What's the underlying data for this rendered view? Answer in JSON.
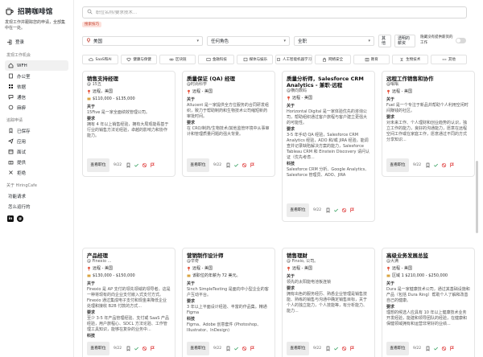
{
  "app": {
    "title": "招聘咖啡馆",
    "tagline": "发现工作并跟踪您的申请，全部集中在一处。",
    "login": "登录"
  },
  "sidebar": {
    "section_work": "发现工作机会",
    "items": [
      {
        "label": "WFH",
        "icon": "home-icon"
      },
      {
        "label": "办公室",
        "icon": "building-icon"
      },
      {
        "label": "依据",
        "icon": "grid-icon"
      },
      {
        "label": "通信",
        "icon": "chat-icon"
      },
      {
        "label": "麻痹",
        "icon": "puzzle-icon"
      }
    ],
    "section_track": "追踪申请",
    "track_items": [
      {
        "label": "已保存",
        "icon": "bookmark-icon"
      },
      {
        "label": "应用",
        "icon": "send-icon"
      },
      {
        "label": "面试",
        "icon": "calendar-icon"
      },
      {
        "label": "提供",
        "icon": "gift-icon"
      },
      {
        "label": "拒绝",
        "icon": "x-icon"
      }
    ],
    "section_about": "关于 HiringCafe",
    "about_items": [
      {
        "label": "功能请求"
      },
      {
        "label": "怎么运行的"
      }
    ],
    "social": [
      "in",
      "@"
    ]
  },
  "search": {
    "placeholder": "职位名称/要求技术..."
  },
  "active_tag": "搜索技巧",
  "filters": {
    "location": "美国",
    "role": "任何角色",
    "time": "全职",
    "more_label": "其他",
    "salary_label": "透明的薪资",
    "hide_label": "隐藏没有提供薪资的工作"
  },
  "categories": [
    {
      "label": "SaaS和AI",
      "icon": "cloud-icon"
    },
    {
      "label": "健康与保健",
      "icon": "heart-icon"
    },
    {
      "label": "区块链",
      "icon": "link-icon"
    },
    {
      "label": "金融科技",
      "icon": "card-icon"
    },
    {
      "label": "媒体与娱乐",
      "icon": "film-icon"
    },
    {
      "label": "人工智能机器学习",
      "icon": "cpu-icon"
    },
    {
      "label": "网络安全",
      "icon": "lock-icon"
    },
    {
      "label": "教育",
      "icon": "book-icon"
    },
    {
      "label": "生物技术",
      "icon": "dna-icon"
    },
    {
      "label": "其他",
      "icon": "dots-icon"
    }
  ],
  "cards": [
    {
      "title": "销售支持经理",
      "company": "@ 15五",
      "location": "远程，美国",
      "salary": "$110,000 - $135,000",
      "about_label": "关于",
      "about": "15Five 是一家全面绩效管理公司。",
      "req_label": "要求",
      "req": "拥有 4 年以上销售经验，拥有大局观能看基于行业的销售方法论经验，卓越的影响力和协作能力。",
      "date": "9/22",
      "view": "查看职位"
    },
    {
      "title": "质量保证 (QA) 经理",
      "company": "@时尚科学",
      "location": "远程 - 美国",
      "salary": "",
      "about_label": "关于",
      "about": "Allucent 是一家提供全方位服务的合同研发组织，致力于帮助制药和生物技术公司缩短新药审批时间。",
      "req_label": "要求",
      "req": "在 CRO/制药/生物技术/其他监管环境中从事审计和管理质量问题的强大背景。",
      "date": "9/22",
      "view": "查看职位"
    },
    {
      "title": "质量分析师，Salesforce CRM Analytics - 兼职·远程",
      "company": "@横向数码",
      "location": "远程 - 美国",
      "salary": "",
      "about_label": "关于",
      "about": "Horizontal Digital 是一家体验优先的咨询公司，帮助组织通过客户旅程与客户建立更强大的可能性。",
      "req_label": "要求",
      "req": "3-5 年手动 QA 经验，Salesforce CRM Analytics 经验，ADO 和/或 JIRA 经验，能调查并记录缺陷解决方案的能力，Salesforce Tableau CRM 和 Einstein Discovery 请问认证（优先考虑...",
      "tech_label": "科技",
      "tech": "Salesforce CRM 分析、Google Analytics、Salesforce 管理员、ADO、JIRA",
      "date": "9/22",
      "view": "查看职位"
    },
    {
      "title": "远程工作销售和协作",
      "company": "@嗡嗡",
      "location": "远程 - 美国",
      "salary": "",
      "about_label": "关于",
      "about": "Fuel 是一个专注于新品并帮助个人利用空闲时间赚钱的社区。",
      "req_label": "要求",
      "req": "对未来工作、个人理财和创业趋势的认识，独立工作的能力，良好的沟通能力，愿意在远程空间工作或在家庭工作，愿意通过不同的方式分享知识...",
      "date": "9/22",
      "view": "查看职位"
    },
    {
      "title": "产品经理",
      "company": "@ Finexio ...",
      "location": "远程 - 美国",
      "salary": "$130,000 - $150,000",
      "about_label": "关于",
      "about": "Finexio 是 AP 支付的领先领域的领导者。这是一种将现有的向企业支付嵌入式支付方式。Finexio 通过集成电子支付和现金来降低企业处理和接收 B2B 付款的方式...",
      "req_label": "要求",
      "req": "至少 3-5 年产品管理经验、支付或 SaaS 产品经验，用户旅程心、SDCL 方法论验、工作管理工具知识，能够在复杂的业务中...",
      "tech_label": "科技",
      "date": "9/22",
      "view": "查看职位"
    },
    {
      "title": "营销制作设计师",
      "company": "@辛奇",
      "location": "远程 - 美国",
      "salary": "该职位的年薪为 72 美元。",
      "about_label": "关于",
      "about": "Sinch SimpleTexting 是面向中小型企业的客户互动平台。",
      "req_label": "要求",
      "req": "3 年以上平面设计经验、丰富的作品集。精通Figma",
      "tech_label": "科技",
      "tech": "Figma、Adobe 创意套件 (Photoshop、Illustrator、InDesign)",
      "date": "9/22",
      "view": "查看职位"
    },
    {
      "title": "销售理财",
      "company": "@ Finxio, 公司。",
      "location": "远程 - 美国",
      "salary": "",
      "about_label": "关于",
      "about": "领先的太阳能电池板连锁",
      "req_label": "要求",
      "req": "拥有出色的服务经历、熟悉企业管理是销售技能、熟练的销售与沟通中确定销售目标，关于个人的独立能力，个人技能等，有分析能力、能力...",
      "date": "9/22",
      "view": "查看职位"
    },
    {
      "title": "高级业务发展总监",
      "company": "@大满",
      "location": "远程 - 美国",
      "salary": "区域 1 $210,000 - $250,000",
      "about_label": "关于",
      "about": "Dura 是一家健康技术公司，通过其基础设施和产品（包括 Dura Ring）帮助个人了解和改善自己的健康。",
      "req_label": "要求",
      "req": "理想的候选人应具有 10 年以上健康技术业务开发经验，能建和领导团队的经验，在健康和保健领域拥有和运营非常好的业绩...",
      "date": "9/22",
      "view": "查看职位"
    }
  ]
}
